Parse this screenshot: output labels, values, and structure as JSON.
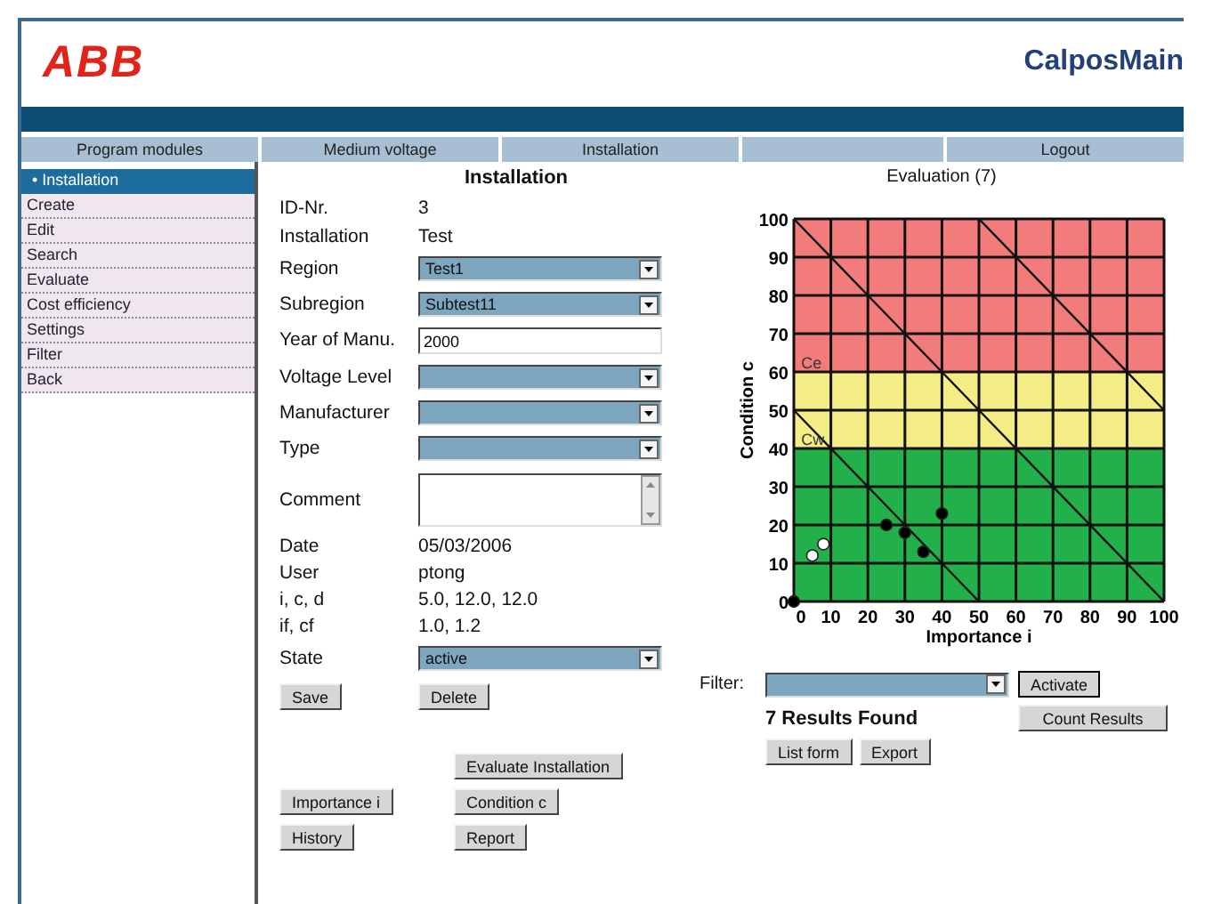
{
  "header": {
    "logo": "ABB",
    "app_title": "CalposMain"
  },
  "nav": {
    "left": [
      "Program modules",
      "Medium voltage",
      "Installation"
    ],
    "right": [
      "Logout"
    ]
  },
  "sidebar": {
    "items": [
      {
        "label": "• Installation",
        "selected": true
      },
      {
        "label": "Create",
        "selected": false
      },
      {
        "label": "Edit",
        "selected": false
      },
      {
        "label": "Search",
        "selected": false
      },
      {
        "label": "Evaluate",
        "selected": false
      },
      {
        "label": "Cost efficiency",
        "selected": false
      },
      {
        "label": "Settings",
        "selected": false
      },
      {
        "label": "Filter",
        "selected": false
      },
      {
        "label": "Back",
        "selected": false
      }
    ]
  },
  "form": {
    "title": "Installation",
    "fields": [
      {
        "kind": "text",
        "label": "ID-Nr.",
        "value": "3"
      },
      {
        "kind": "text",
        "label": "Installation",
        "value": "Test"
      },
      {
        "kind": "select",
        "label": "Region",
        "value": "Test1"
      },
      {
        "kind": "select",
        "label": "Subregion",
        "value": "Subtest11"
      },
      {
        "kind": "input",
        "label": "Year of Manu.",
        "value": "2000"
      },
      {
        "kind": "select",
        "label": "Voltage Level"
      },
      {
        "kind": "select",
        "label": "Manufacturer"
      },
      {
        "kind": "select",
        "label": "Type"
      },
      {
        "kind": "textarea",
        "label": "Comment"
      },
      {
        "kind": "info",
        "label": "Date",
        "value": "05/03/2006"
      },
      {
        "kind": "info",
        "label": "User",
        "value": "ptong"
      },
      {
        "kind": "info",
        "label": "i, c, d",
        "value": "5.0, 12.0, 12.0"
      },
      {
        "kind": "info",
        "label": "if, cf",
        "value": "1.0, 1.2"
      },
      {
        "kind": "select",
        "label": "State",
        "value": "active"
      }
    ],
    "actions": [
      "Save",
      "Delete"
    ],
    "button_rows": [
      [
        null,
        "Evaluate Installation"
      ],
      [
        "Importance i",
        "Condition c"
      ],
      [
        "History",
        "Report"
      ]
    ]
  },
  "evaluation": {
    "title": "Evaluation (7)",
    "chart_data": {
      "type": "scatter",
      "xlabel": "Importance i",
      "ylabel": "Condition c",
      "xlim": [
        0,
        100
      ],
      "ylim": [
        0,
        100
      ],
      "xticks": [
        0,
        10,
        20,
        30,
        40,
        50,
        60,
        70,
        80,
        90,
        100
      ],
      "yticks": [
        0,
        10,
        20,
        30,
        40,
        50,
        60,
        70,
        80,
        90,
        100
      ],
      "x": [
        0,
        5,
        8,
        25,
        30,
        35,
        40,
        50,
        100
      ],
      "series": [
        {
          "color": "#000000",
          "values": [
            0,
            null,
            null,
            20,
            18,
            13,
            23,
            null,
            null
          ]
        },
        {
          "color": "#ffffff",
          "values": [
            null,
            12,
            15,
            null,
            null,
            null,
            null,
            null,
            null
          ]
        },
        {
          "type": "line",
          "color": "#111111",
          "values": [
            100,
            95,
            92,
            75,
            70,
            65,
            60,
            50,
            0
          ]
        },
        {
          "type": "line",
          "color": "#111111",
          "values": [
            null,
            null,
            null,
            null,
            null,
            null,
            null,
            100,
            50
          ]
        },
        {
          "type": "line",
          "color": "#111111",
          "values": [
            50,
            45,
            42,
            25,
            20,
            15,
            10,
            0,
            null
          ]
        }
      ],
      "grid": true,
      "bands": [
        {
          "axis": "y",
          "from": 60,
          "to": 100,
          "color": "#f27c7c"
        },
        {
          "axis": "y",
          "from": 40,
          "to": 60,
          "color": "#f4ec84"
        },
        {
          "axis": "y",
          "from": 0,
          "to": 40,
          "color": "#22b04a"
        }
      ],
      "annotations": [
        "Ce",
        "Cw"
      ]
    },
    "filter_label": "Filter:",
    "activate": "Activate",
    "results": "7 Results Found",
    "count_button": "Count Results",
    "buttons": [
      "List form",
      "Export"
    ]
  }
}
